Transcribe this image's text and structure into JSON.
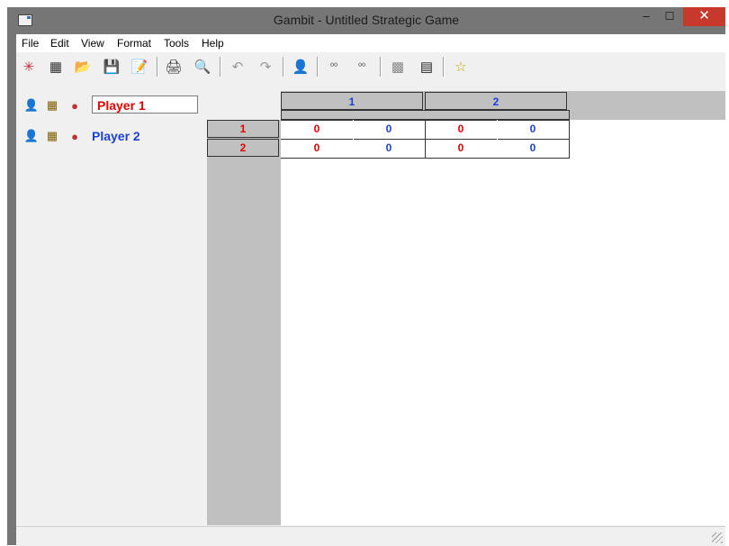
{
  "window": {
    "title": "Gambit - Untitled Strategic Game",
    "minimize": "–",
    "maximize": "☐",
    "close": "✕"
  },
  "menu": [
    "File",
    "Edit",
    "View",
    "Format",
    "Tools",
    "Help"
  ],
  "toolbar": [
    {
      "name": "new-extensive-game-icon",
      "glyph": "✳"
    },
    {
      "name": "new-strategic-game-icon",
      "glyph": "▦"
    },
    {
      "name": "open-icon",
      "glyph": "📂"
    },
    {
      "name": "save-icon",
      "glyph": "💾"
    },
    {
      "name": "save-as-icon",
      "glyph": "📝"
    },
    {
      "name": "print-icon",
      "glyph": "🖨"
    },
    {
      "name": "print-preview-icon",
      "glyph": "🔍"
    },
    {
      "name": "undo-icon",
      "glyph": "↶"
    },
    {
      "name": "redo-icon",
      "glyph": "↷"
    },
    {
      "name": "add-player-icon",
      "glyph": "👤"
    },
    {
      "name": "decimal-increase-icon",
      "glyph": "⁰⁰"
    },
    {
      "name": "decimal-decrease-icon",
      "glyph": "⁰⁰"
    },
    {
      "name": "dominance-icon",
      "glyph": "▩"
    },
    {
      "name": "calculator-icon",
      "glyph": "▤"
    },
    {
      "name": "equilibria-icon",
      "glyph": "☆"
    }
  ],
  "players": [
    {
      "name": "Player 1",
      "color": "#e00000"
    },
    {
      "name": "Player 2",
      "color": "#1c3fd8"
    }
  ],
  "matrix": {
    "col_strategies": [
      "1",
      "2"
    ],
    "row_strategies": [
      "1",
      "2"
    ],
    "payoffs": [
      [
        [
          "0",
          "0"
        ],
        [
          "0",
          "0"
        ]
      ],
      [
        [
          "0",
          "0"
        ],
        [
          "0",
          "0"
        ]
      ]
    ]
  },
  "colors": {
    "player1": "#e00000",
    "player2": "#1c3fd8",
    "close": "#c7392c",
    "titlebar": "#767676"
  }
}
